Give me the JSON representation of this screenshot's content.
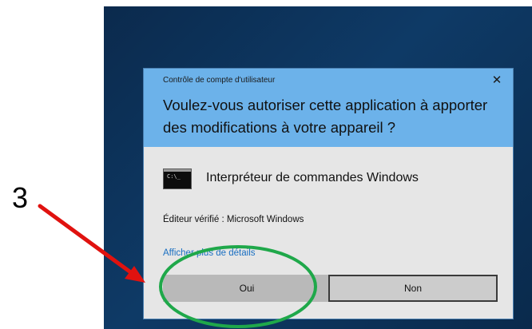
{
  "dialog": {
    "title": "Contrôle de compte d'utilisateur",
    "close_glyph": "✕",
    "question": "Voulez-vous autoriser cette application à apporter des modifications à votre appareil ?",
    "app_icon_glyph": "C:\\_",
    "app_name": "Interpréteur de commandes Windows",
    "publisher": "Éditeur vérifié : Microsoft Windows",
    "details_link": "Afficher plus de détails",
    "yes_label": "Oui",
    "no_label": "Non"
  },
  "annotation": {
    "step_number": "3",
    "arrow_color": "#e0120f",
    "circle_color": "#1fa84a"
  },
  "colors": {
    "header_bg": "#6cb2ea",
    "body_bg": "#e6e6e6",
    "link": "#1a6fc2",
    "desktop_bg": "#0e3a66"
  }
}
